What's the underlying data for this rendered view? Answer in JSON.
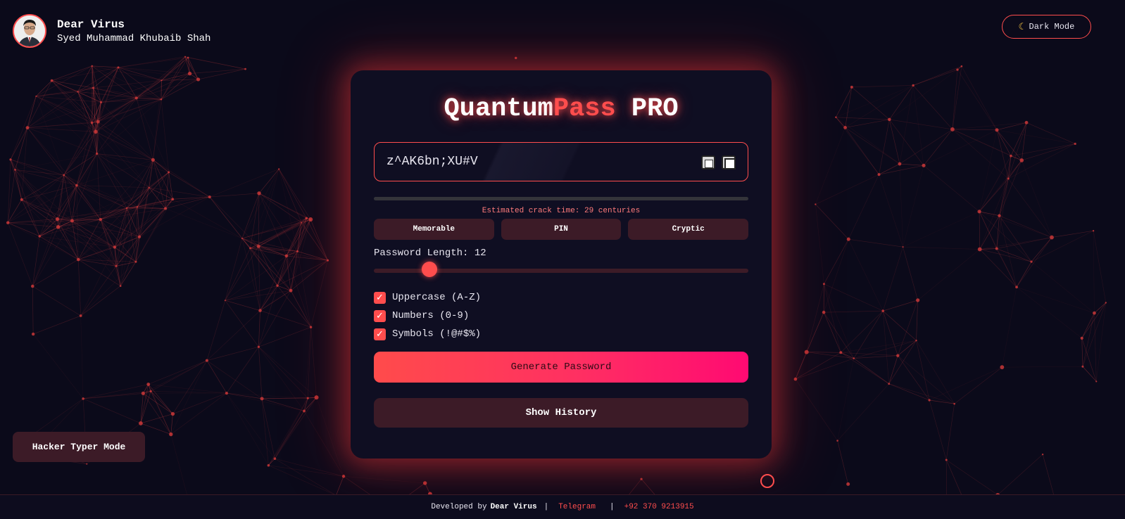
{
  "profile": {
    "name": "Dear Virus",
    "full_name": "Syed Muhammad Khubaib Shah"
  },
  "header": {
    "dark_mode_label": "Dark Mode",
    "dark_mode_icon": "moon-icon"
  },
  "generator": {
    "title_part1": "Quantum",
    "title_part2": "Pass",
    "title_part3": " PRO",
    "password": "z^AK6bn;XU#V",
    "copy_icon": "clipboard-icon",
    "expand_icon": "fullscreen-icon",
    "crack_time": "Estimated crack time: 29 centuries",
    "modes": [
      "Memorable",
      "PIN",
      "Cryptic"
    ],
    "length_label": "Password Length: ",
    "length_value": "12",
    "length_value_num": 12,
    "options": [
      {
        "label": "Uppercase (A-Z)",
        "checked": true
      },
      {
        "label": "Numbers (0-9)",
        "checked": true
      },
      {
        "label": "Symbols (!@#$%)",
        "checked": true
      }
    ],
    "generate_label": "Generate Password",
    "history_label": "Show History"
  },
  "hacker_mode_label": "Hacker Typer Mode",
  "footer": {
    "developed_by": "Developed by",
    "developer": "Dear Virus",
    "sep1": "|",
    "telegram": "Telegram",
    "sep2": "|",
    "phone": "+92 370 9213915"
  },
  "colors": {
    "accent": "#ff4d4d",
    "background": "#0b0a1a",
    "card": "#0f0e22",
    "button_muted": "#3c1b27",
    "gradient_end": "#ff0a72"
  }
}
